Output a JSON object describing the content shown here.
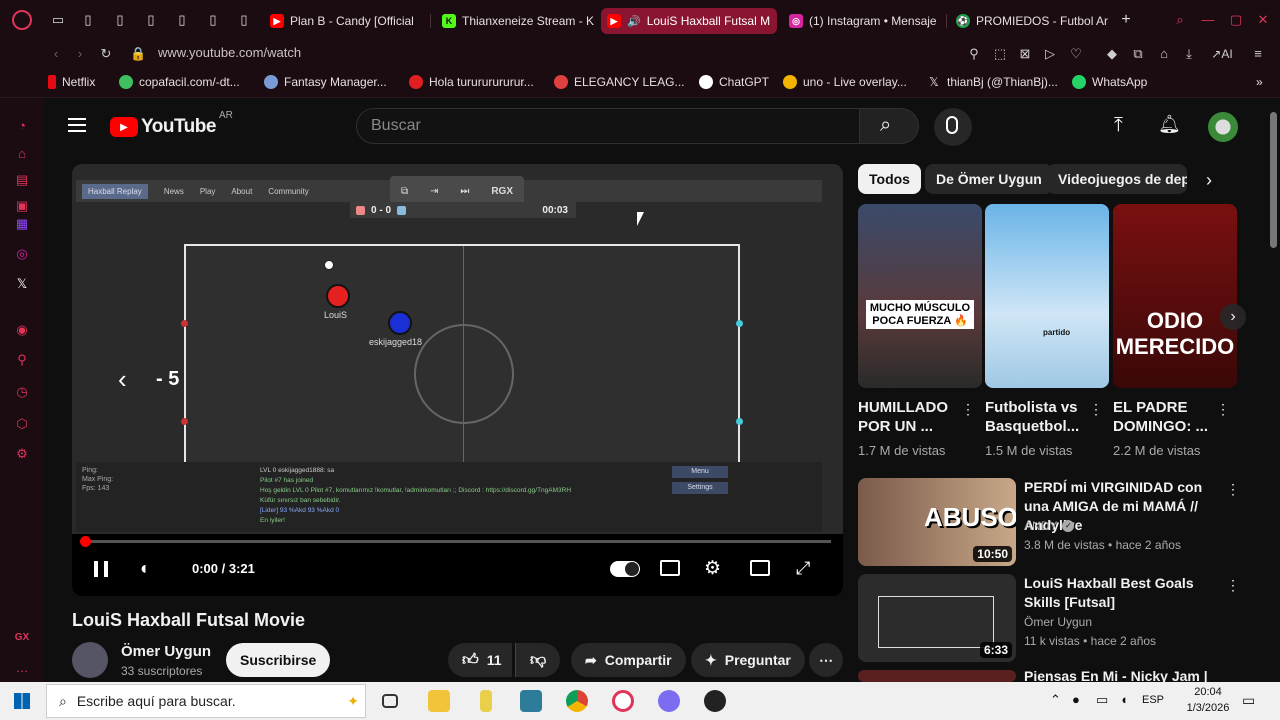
{
  "browser": {
    "tabs": [
      {
        "label": "Plan B - Candy [Official",
        "color": "#ff0000"
      },
      {
        "label": "Thianxeneize Stream - K",
        "color": "#53fc18"
      },
      {
        "label": "LouiS Haxball Futsal M",
        "color": "#ff0000"
      },
      {
        "label": "(1) Instagram • Mensaje",
        "color": "#d6249f"
      },
      {
        "label": "PROMIEDOS - Futbol Ar",
        "color": "#1aa34a"
      }
    ],
    "url": "www.youtube.com/watch",
    "address_icons": [
      "pin-icon",
      "snapshot-icon",
      "shield-icon",
      "play-icon",
      "heart-icon",
      "wallet-icon",
      "extensions-icon",
      "profile-icon",
      "download-icon",
      "ai-icon",
      "menu-icon"
    ],
    "ai_label": "AI",
    "bookmarks": [
      {
        "label": "Netflix",
        "color": "#e50914"
      },
      {
        "label": "copafacil.com/-dt...",
        "color": "#3fbf5f"
      },
      {
        "label": "Fantasy Manager...",
        "color": "#7a9cd6"
      },
      {
        "label": "Hola turururururur...",
        "color": "#e02020"
      },
      {
        "label": "ELEGANCY LEAG...",
        "color": "#e04040"
      },
      {
        "label": "ChatGPT",
        "color": "#ffffff"
      },
      {
        "label": "uno - Live overlay...",
        "color": "#f2b400"
      },
      {
        "label": "thianBj (@ThianBj)...",
        "color": "#ffffff"
      },
      {
        "label": "WhatsApp",
        "color": "#25d366"
      }
    ]
  },
  "youtube": {
    "logo": "YouTube",
    "region": "AR",
    "search_placeholder": "Buscar",
    "player": {
      "time": "0:00 / 3:21",
      "seek_label": "- 5",
      "game": {
        "score": "0 - 0",
        "clock": "00:03",
        "nav": [
          "Haxball Replay",
          "News",
          "Play",
          "About",
          "Community"
        ],
        "overlay_btn": "RGX",
        "player_red": "LouiS",
        "player_blue": "eskijagged18",
        "stats": [
          "Ping:",
          "Max Ping:",
          "Fps: 143"
        ],
        "chat": [
          "LVL 0 eskijagged1888: sa",
          "Pilot #7 has joined",
          "Hoş geldin LVL 0 Pilot #7, komutlarımız !komutlar, !adminkomutları ;; Discord : https://discord.gg/TngAM3RH",
          "Küfür sınırsız ban sebebidir.",
          "[Lider] 93 %Akd 93 %Akd 0",
          "En iyiler!"
        ],
        "menu": "Menu",
        "settings": "Settings"
      },
      "accent": "#ff0000"
    },
    "video_title": "LouiS Haxball Futsal Movie",
    "channel": {
      "name": "Ömer Uygun",
      "subs": "33 suscriptores",
      "subscribe": "Suscribirse"
    },
    "actions": {
      "likes": "11",
      "share": "Compartir",
      "ask": "Preguntar"
    },
    "chips": [
      "Todos",
      "De Ömer Uygun",
      "Videojuegos de depor"
    ],
    "shorts": [
      {
        "title": "HUMILLADO POR UN ...",
        "views": "1.7 M de vistas",
        "overlay": "MUCHO MÚSCULO POCA FUERZA 🔥"
      },
      {
        "title": "Futbolista vs Basquetbol...",
        "views": "1.5 M de vistas",
        "overlay": "partido"
      },
      {
        "title": "EL PADRE DOMINGO: ...",
        "views": "2.2 M de vistas",
        "overlay": "ODIO MERECIDO"
      }
    ],
    "related": [
      {
        "title": "PERDÍ mi VIRGINIDAD con una AMIGA de mi MAMÁ // Andylive",
        "channel": "ANDY",
        "meta": "3.8 M de vistas • hace 2 años",
        "duration": "10:50",
        "thumb_text": "ABUSO?"
      },
      {
        "title": "LouiS Haxball Best Goals Skills [Futsal]",
        "channel": "Ömer Uygun",
        "meta": "11 k vistas • hace 2 años",
        "duration": "6:33",
        "thumb_text": ""
      },
      {
        "title": "Piensas En Mi - Nicky Jam |",
        "channel": "",
        "meta": "",
        "duration": "",
        "thumb_text": ""
      }
    ]
  },
  "taskbar": {
    "search_placeholder": "Escribe aquí para buscar.",
    "lang": "ESP",
    "time": "20:04",
    "date": "1/3/2026"
  },
  "sidebar": {
    "label": "GX",
    "icons": [
      "dice-icon",
      "bag-icon",
      "card-icon",
      "menu-icon",
      "twitch-icon",
      "instagram-icon",
      "x-icon",
      "player-icon",
      "pin-icon",
      "clock-icon",
      "cube-icon",
      "settings-icon"
    ]
  }
}
